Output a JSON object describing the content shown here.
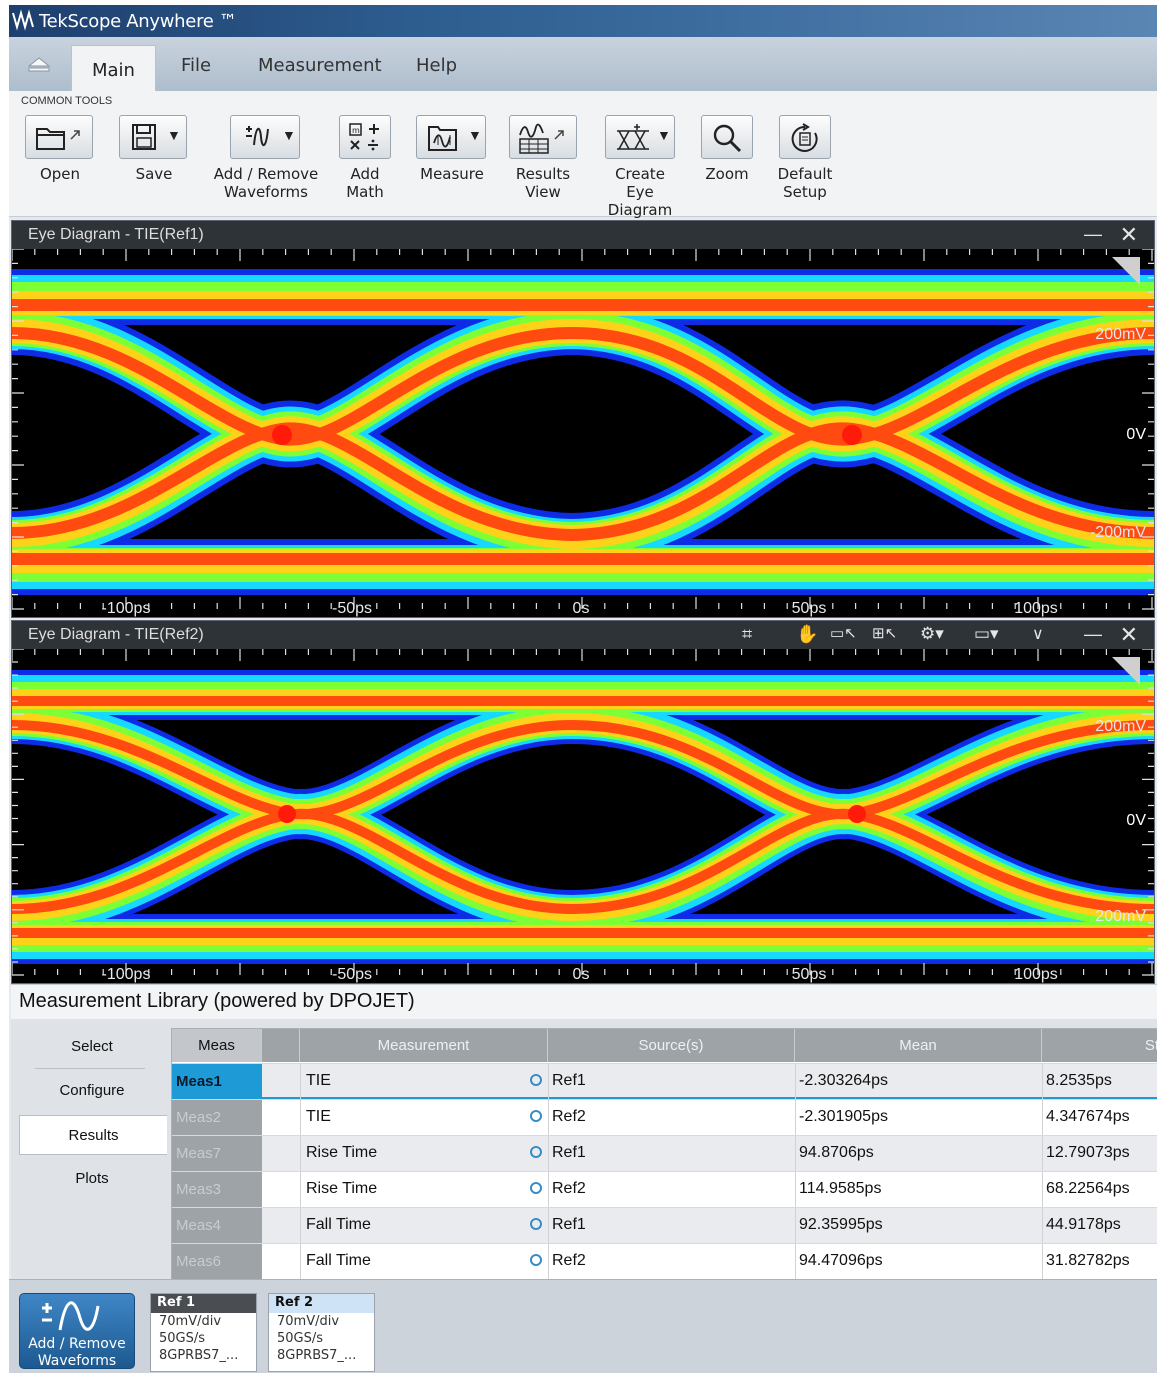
{
  "app": {
    "title": "TekScope Anywhere ™"
  },
  "menu": {
    "main": "Main",
    "file": "File",
    "measurement": "Measurement",
    "help": "Help"
  },
  "ribbon": {
    "group_label": "COMMON TOOLS",
    "tools": {
      "open": "Open",
      "save": "Save",
      "add_remove": "Add / Remove\nWaveforms",
      "add_math": "Add\nMath",
      "measure": "Measure",
      "results_view": "Results\nView",
      "create_eye": "Create Eye\nDiagram",
      "zoom": "Zoom",
      "default_setup": "Default\nSetup"
    }
  },
  "plots": [
    {
      "title": "Eye Diagram - TIE(Ref1)",
      "y_labels": {
        "top": "200mV",
        "mid": "0V",
        "bottom": "-200mV"
      },
      "x_labels": [
        "-100ps",
        "-50ps",
        "0s",
        "50ps",
        "100ps"
      ]
    },
    {
      "title": "Eye Diagram - TIE(Ref2)",
      "y_labels": {
        "top": "200mV",
        "mid": "0V",
        "bottom": "200mV"
      },
      "x_labels": [
        "-100ps",
        "-50ps",
        "0s",
        "50ps",
        "100ps"
      ]
    }
  ],
  "measurement_library": {
    "title": "Measurement Library (powered by DPOJET)",
    "side": {
      "select": "Select",
      "configure": "Configure",
      "results": "Results",
      "plots": "Plots"
    },
    "columns": {
      "meas": "Meas",
      "measurement": "Measurement",
      "sources": "Source(s)",
      "mean": "Mean",
      "std": "St"
    },
    "rows": [
      {
        "id": "Meas1",
        "name": "TIE",
        "source": "Ref1",
        "mean": "-2.303264ps",
        "std": "8.2535ps"
      },
      {
        "id": "Meas2",
        "name": "TIE",
        "source": "Ref2",
        "mean": "-2.301905ps",
        "std": "4.347674ps"
      },
      {
        "id": "Meas7",
        "name": "Rise Time",
        "source": "Ref1",
        "mean": "94.8706ps",
        "std": "12.79073ps"
      },
      {
        "id": "Meas3",
        "name": "Rise Time",
        "source": "Ref2",
        "mean": "114.9585ps",
        "std": "68.22564ps"
      },
      {
        "id": "Meas4",
        "name": "Fall Time",
        "source": "Ref1",
        "mean": "92.35995ps",
        "std": "44.9178ps"
      },
      {
        "id": "Meas6",
        "name": "Fall Time",
        "source": "Ref2",
        "mean": "94.47096ps",
        "std": "31.82782ps"
      }
    ]
  },
  "bottom": {
    "add_remove": "Add / Remove\nWaveforms",
    "refs": [
      {
        "name": "Ref 1",
        "scale": "70mV/div",
        "rate": "50GS/s",
        "pattern": "8GPRBS7_..."
      },
      {
        "name": "Ref 2",
        "scale": "70mV/div",
        "rate": "50GS/s",
        "pattern": "8GPRBS7_..."
      }
    ]
  },
  "colors": {
    "accent": "#1e9bd7",
    "titlebar": "#2d5c8e",
    "ref2": "#cfe3f7"
  }
}
